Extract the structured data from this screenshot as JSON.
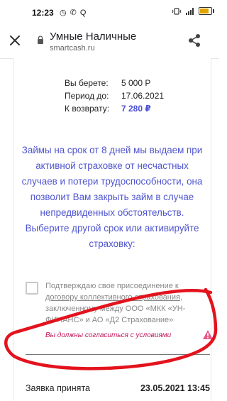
{
  "status_bar": {
    "time": "12:23",
    "left_icons": "◷ ✆ Q",
    "right_icons": [
      "vibrate-icon",
      "signal-icon"
    ],
    "battery_level_percent": 80,
    "battery_color": "#e0a400"
  },
  "header": {
    "site_title": "Умные Наличные",
    "url": "smartcash.ru",
    "close_icon": "close-icon",
    "share_icon": "share-icon"
  },
  "summary": {
    "rows": [
      {
        "label": "Вы берете:",
        "value": "5 000 Р"
      },
      {
        "label": "Период до:",
        "value": "17.06.2021"
      },
      {
        "label": "К возврату:",
        "value": "7 280 ₽"
      }
    ]
  },
  "insurance_text": "Займы на срок от 8 дней мы выдаем при активной страховке от несчастных случаев и потери трудоспособности, она позволит Вам закрыть займ в случае непредвиденных обстоятельств. Выберите другой срок или активируйте страховку:",
  "consent": {
    "text_before": "Подтверждаю свое присоединение к",
    "link": "договору коллективного страхования",
    "text_after": ", заключенному между ООО «МКК «УН-ФИНАНС» и АО «Д2 Страхование»",
    "error": "Вы должны согласиться с условиями"
  },
  "application_status": {
    "label": "Заявка принята",
    "datetime": "23.05.2021 13:45"
  },
  "colors": {
    "accent": "#4a4fd8",
    "text_purple": "#4f55cf",
    "error": "#c2185b",
    "annotation": "#e3131d"
  }
}
